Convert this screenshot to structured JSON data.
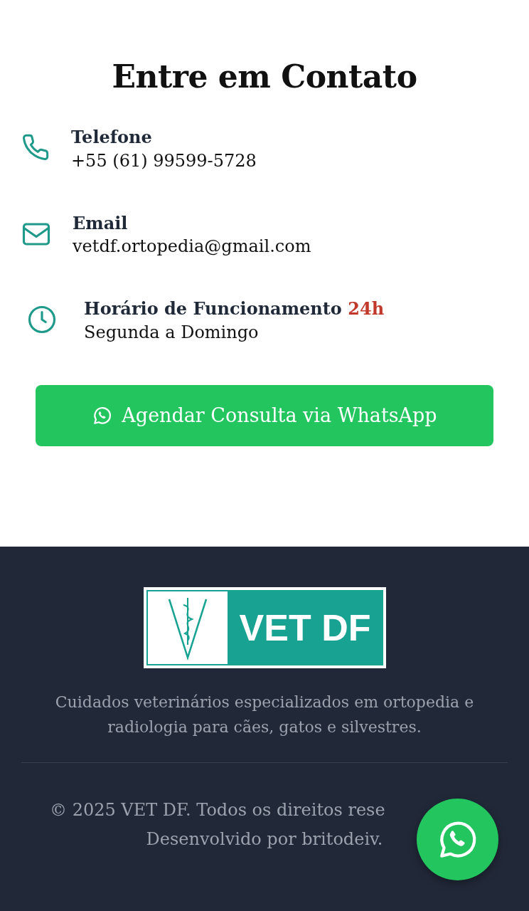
{
  "heading": "Entre em Contato",
  "contacts": [
    {
      "kind": "phone",
      "label": "Telefone",
      "value": "+55 (61) 99599-5728"
    },
    {
      "kind": "email",
      "label": "Email",
      "value": "vetdf.ortopedia@gmail.com"
    },
    {
      "kind": "hours",
      "label": "Horário de Funcionamento",
      "highlight": "24h",
      "value": "Segunda a Domingo"
    }
  ],
  "cta": {
    "label": "Agendar Consulta via WhatsApp"
  },
  "footer": {
    "logo_text": "VET DF",
    "tagline": "Cuidados veterinários especializados em ortopedia e radiologia para cães, gatos e silvestres.",
    "copyright": "© 2025 VET DF. Todos os direitos rese",
    "credit": "Desenvolvido por britodeiv."
  }
}
